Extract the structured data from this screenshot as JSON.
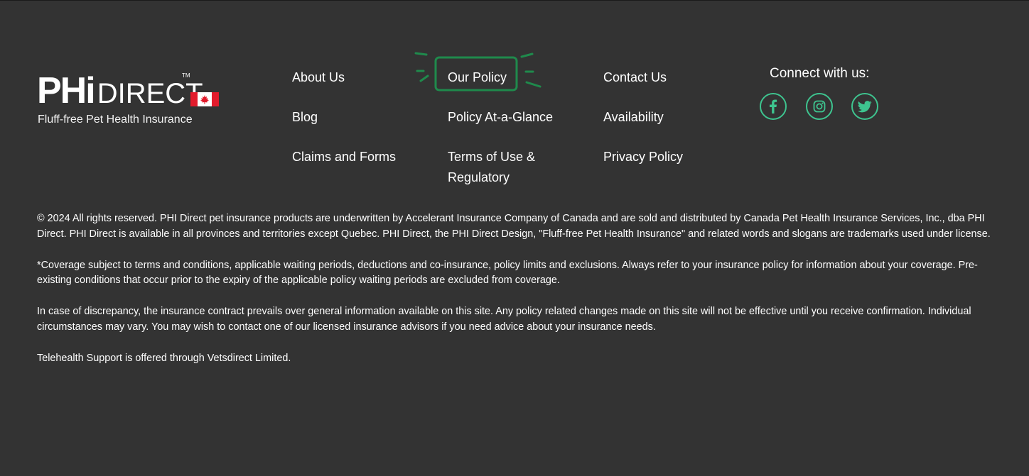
{
  "logo": {
    "brand_mark": "PHi",
    "brand_word": "DIRECT",
    "tm": "TM",
    "tagline": "Fluff-free Pet Health Insurance"
  },
  "nav": {
    "col1": [
      "About Us",
      "Blog",
      "Claims and Forms"
    ],
    "col2": [
      "Our Policy",
      "Policy At-a-Glance",
      "Terms of Use & Regulatory"
    ],
    "col3": [
      "Contact Us",
      "Availability",
      "Privacy Policy"
    ]
  },
  "social": {
    "title": "Connect with us:",
    "icons": [
      "facebook-icon",
      "instagram-icon",
      "twitter-icon"
    ]
  },
  "legal": {
    "copyright": "© 2024 All rights reserved. PHI Direct pet insurance products are underwritten by Accelerant Insurance Company of Canada and are sold and distributed by Canada Pet Health Insurance Services, Inc., dba PHI Direct. PHI Direct is available in all provinces and territories except Quebec. PHI Direct, the PHI Direct Design, \"Fluff-free Pet Health Insurance\" and related words and slogans are trademarks used under license.",
    "coverage": "*Coverage subject to terms and conditions, applicable waiting periods, deductions and co-insurance, policy limits and exclusions. Always refer to your insurance policy for information about your coverage. Pre-existing conditions that occur prior to the expiry of the applicable policy waiting periods are excluded from coverage.",
    "discrepancy": "In case of discrepancy, the insurance contract prevails over general information available on this site. Any policy related changes made on this site will not be effective until you receive confirmation. Individual circumstances may vary. You may wish to contact one of our licensed insurance advisors if you need advice about your insurance needs.",
    "telehealth": "Telehealth Support is offered through Vetsdirect Limited."
  },
  "colors": {
    "background": "#333333",
    "accent_green": "#3ec48f",
    "highlight_green": "#1f8a4c",
    "flag_red": "#e21b2c"
  }
}
